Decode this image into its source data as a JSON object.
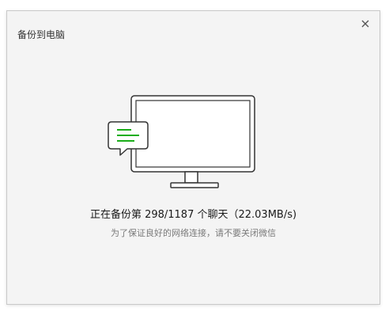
{
  "dialog": {
    "title": "备份到电脑",
    "close_icon": "close-icon",
    "status": "正在备份第 298/1187 个聊天（22.03MB/s)",
    "hint": "为了保证良好的网络连接，请不要关闭微信"
  },
  "illustration": {
    "icons": [
      "monitor-icon",
      "chat-bubble-icon"
    ],
    "accent_color": "#1aad19",
    "line_color": "#333333"
  }
}
